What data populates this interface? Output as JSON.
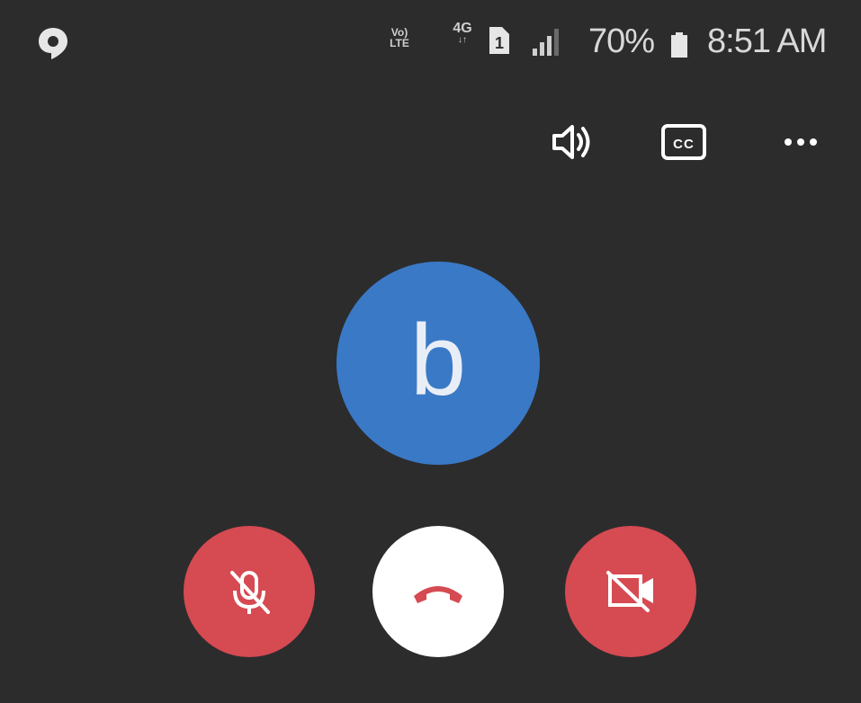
{
  "status_bar": {
    "network_type_top": "Vo)",
    "network_type_bottom": "LTE",
    "data_type": "4G",
    "data_arrows": "↓↑",
    "sim_slot": "1",
    "battery_percent": "70%",
    "time": "8:51 AM"
  },
  "toolbar": {
    "icons": [
      "speaker-icon",
      "closed-captions-icon",
      "more-options-icon"
    ],
    "cc_label": "CC"
  },
  "contact": {
    "avatar_letter": "b",
    "avatar_color": "#3a79c6"
  },
  "controls": {
    "mic": {
      "icon": "mic-off-icon",
      "state": "muted",
      "color": "#d64a52"
    },
    "end_call": {
      "icon": "end-call-icon",
      "color": "#ffffff",
      "icon_color": "#d64a52"
    },
    "video": {
      "icon": "video-off-icon",
      "state": "off",
      "color": "#d64a52"
    }
  },
  "theme": {
    "background": "#2c2c2d",
    "text": "#d8d8d8"
  }
}
